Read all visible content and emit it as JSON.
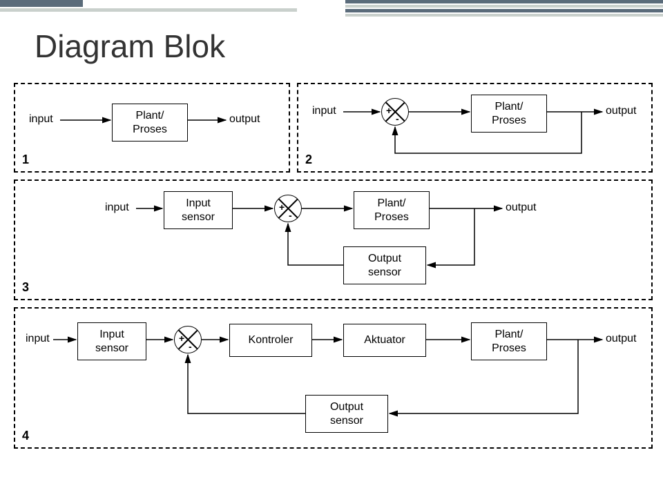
{
  "title": "Diagram Blok",
  "labels": {
    "input": "input",
    "output": "output",
    "plant": "Plant/\nProses",
    "input_sensor": "Input\nsensor",
    "output_sensor": "Output\nsensor",
    "kontroler": "Kontroler",
    "aktuator": "Aktuator",
    "plus": "+",
    "minus": "-"
  },
  "panels": {
    "p1": "1",
    "p2": "2",
    "p3": "3",
    "p4": "4"
  },
  "diagram": {
    "type": "block-diagram",
    "panels": [
      {
        "id": 1,
        "desc": "Open loop: input -> Plant/Proses -> output"
      },
      {
        "id": 2,
        "desc": "Closed loop (unity feedback): input -> summing(+,-) -> Plant/Proses -> output; feedback from output to summing(-)"
      },
      {
        "id": 3,
        "desc": "Closed loop with sensors: input -> Input sensor -> summing(+,-) -> Plant/Proses -> output; feedback via Output sensor to summing(-)"
      },
      {
        "id": 4,
        "desc": "Full control loop: input -> Input sensor -> summing(+,-) -> Kontroler -> Aktuator -> Plant/Proses -> output; feedback via Output sensor to summing(-)"
      }
    ]
  }
}
